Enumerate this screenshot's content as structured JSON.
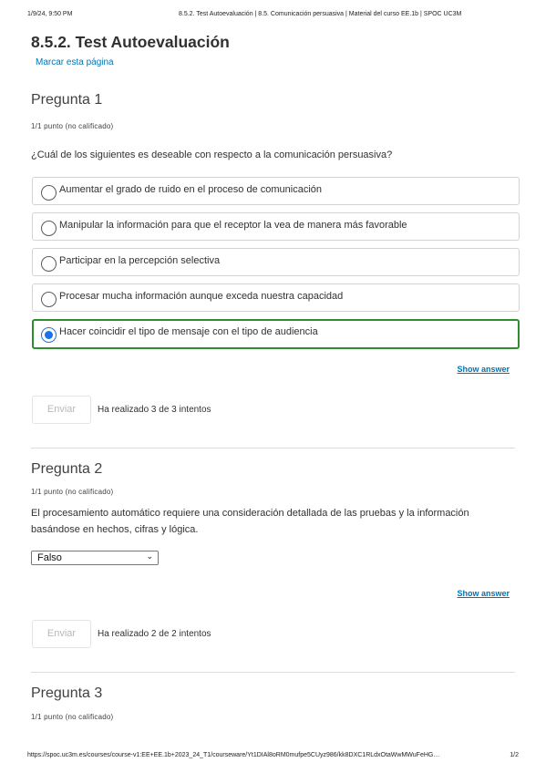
{
  "print_header": {
    "date": "1/9/24, 9:50 PM",
    "title": "8.5.2. Test Autoevaluación | 8.5. Comunicación persuasiva | Material del curso EE.1b | SPOC UC3M"
  },
  "page": {
    "title": "8.5.2. Test Autoevaluación",
    "bookmark": "Marcar esta página"
  },
  "questions": [
    {
      "title": "Pregunta 1",
      "points": "1/1 punto (no calificado)",
      "text": "¿Cuál de los siguientes es deseable con respecto a la comunicación persuasiva?",
      "options": [
        "Aumentar el grado de ruido en el proceso de comunicación",
        "Manipular la información para que el receptor la vea de manera más favorable",
        "Participar en la percepción selectiva",
        "Procesar mucha información aunque exceda nuestra capacidad",
        "Hacer coincidir el tipo de mensaje con el tipo de audiencia"
      ],
      "selected_option": "Hacer coincidir el tipo de mensaje con el tipo de audiencia",
      "show_answer": "Show answer",
      "submit": "Enviar",
      "attempts": "Ha realizado 3 de 3 intentos"
    },
    {
      "title": "Pregunta 2",
      "points": "1/1 punto (no calificado)",
      "text": "El procesamiento automático requiere una consideración detallada de las pruebas y la información basándose en hechos, cifras y lógica.",
      "select_value": "Falso",
      "show_answer": "Show answer",
      "submit": "Enviar",
      "attempts": "Ha realizado 2 de 2 intentos"
    },
    {
      "title": "Pregunta 3",
      "points": "1/1 punto (no calificado)"
    }
  ],
  "print_footer": {
    "url": "https://spoc.uc3m.es/courses/course-v1:EE+EE.1b+2023_24_T1/courseware/Yt1DIAl8oRM0mufpe5CUyz986/kk8DXC1RLdxOtaWwMWuFeHG…",
    "page": "1/2"
  },
  "colors": {
    "link": "#0075b4",
    "selected_border": "#2e8d2e",
    "radio_selected": "#1a73e8"
  }
}
